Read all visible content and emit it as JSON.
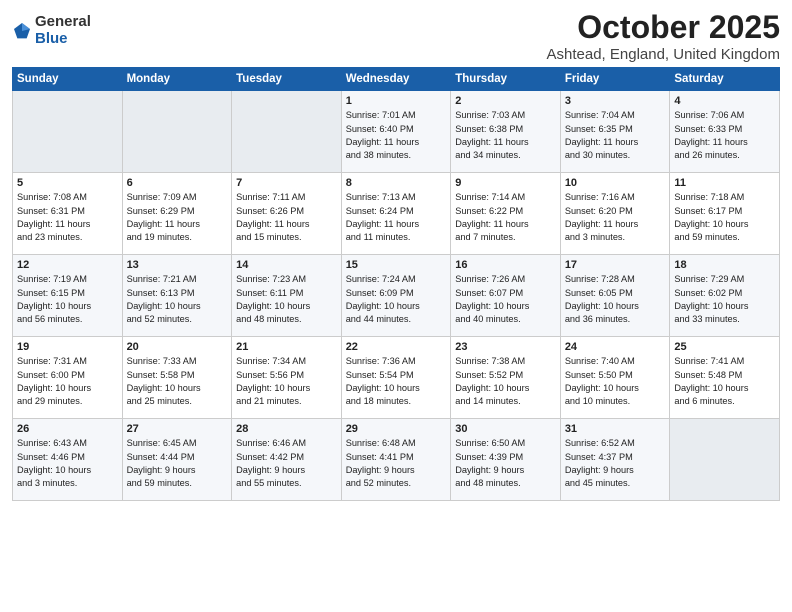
{
  "logo": {
    "general": "General",
    "blue": "Blue"
  },
  "header": {
    "month": "October 2025",
    "location": "Ashtead, England, United Kingdom"
  },
  "weekdays": [
    "Sunday",
    "Monday",
    "Tuesday",
    "Wednesday",
    "Thursday",
    "Friday",
    "Saturday"
  ],
  "weeks": [
    [
      {
        "day": "",
        "info": ""
      },
      {
        "day": "",
        "info": ""
      },
      {
        "day": "",
        "info": ""
      },
      {
        "day": "1",
        "info": "Sunrise: 7:01 AM\nSunset: 6:40 PM\nDaylight: 11 hours\nand 38 minutes."
      },
      {
        "day": "2",
        "info": "Sunrise: 7:03 AM\nSunset: 6:38 PM\nDaylight: 11 hours\nand 34 minutes."
      },
      {
        "day": "3",
        "info": "Sunrise: 7:04 AM\nSunset: 6:35 PM\nDaylight: 11 hours\nand 30 minutes."
      },
      {
        "day": "4",
        "info": "Sunrise: 7:06 AM\nSunset: 6:33 PM\nDaylight: 11 hours\nand 26 minutes."
      }
    ],
    [
      {
        "day": "5",
        "info": "Sunrise: 7:08 AM\nSunset: 6:31 PM\nDaylight: 11 hours\nand 23 minutes."
      },
      {
        "day": "6",
        "info": "Sunrise: 7:09 AM\nSunset: 6:29 PM\nDaylight: 11 hours\nand 19 minutes."
      },
      {
        "day": "7",
        "info": "Sunrise: 7:11 AM\nSunset: 6:26 PM\nDaylight: 11 hours\nand 15 minutes."
      },
      {
        "day": "8",
        "info": "Sunrise: 7:13 AM\nSunset: 6:24 PM\nDaylight: 11 hours\nand 11 minutes."
      },
      {
        "day": "9",
        "info": "Sunrise: 7:14 AM\nSunset: 6:22 PM\nDaylight: 11 hours\nand 7 minutes."
      },
      {
        "day": "10",
        "info": "Sunrise: 7:16 AM\nSunset: 6:20 PM\nDaylight: 11 hours\nand 3 minutes."
      },
      {
        "day": "11",
        "info": "Sunrise: 7:18 AM\nSunset: 6:17 PM\nDaylight: 10 hours\nand 59 minutes."
      }
    ],
    [
      {
        "day": "12",
        "info": "Sunrise: 7:19 AM\nSunset: 6:15 PM\nDaylight: 10 hours\nand 56 minutes."
      },
      {
        "day": "13",
        "info": "Sunrise: 7:21 AM\nSunset: 6:13 PM\nDaylight: 10 hours\nand 52 minutes."
      },
      {
        "day": "14",
        "info": "Sunrise: 7:23 AM\nSunset: 6:11 PM\nDaylight: 10 hours\nand 48 minutes."
      },
      {
        "day": "15",
        "info": "Sunrise: 7:24 AM\nSunset: 6:09 PM\nDaylight: 10 hours\nand 44 minutes."
      },
      {
        "day": "16",
        "info": "Sunrise: 7:26 AM\nSunset: 6:07 PM\nDaylight: 10 hours\nand 40 minutes."
      },
      {
        "day": "17",
        "info": "Sunrise: 7:28 AM\nSunset: 6:05 PM\nDaylight: 10 hours\nand 36 minutes."
      },
      {
        "day": "18",
        "info": "Sunrise: 7:29 AM\nSunset: 6:02 PM\nDaylight: 10 hours\nand 33 minutes."
      }
    ],
    [
      {
        "day": "19",
        "info": "Sunrise: 7:31 AM\nSunset: 6:00 PM\nDaylight: 10 hours\nand 29 minutes."
      },
      {
        "day": "20",
        "info": "Sunrise: 7:33 AM\nSunset: 5:58 PM\nDaylight: 10 hours\nand 25 minutes."
      },
      {
        "day": "21",
        "info": "Sunrise: 7:34 AM\nSunset: 5:56 PM\nDaylight: 10 hours\nand 21 minutes."
      },
      {
        "day": "22",
        "info": "Sunrise: 7:36 AM\nSunset: 5:54 PM\nDaylight: 10 hours\nand 18 minutes."
      },
      {
        "day": "23",
        "info": "Sunrise: 7:38 AM\nSunset: 5:52 PM\nDaylight: 10 hours\nand 14 minutes."
      },
      {
        "day": "24",
        "info": "Sunrise: 7:40 AM\nSunset: 5:50 PM\nDaylight: 10 hours\nand 10 minutes."
      },
      {
        "day": "25",
        "info": "Sunrise: 7:41 AM\nSunset: 5:48 PM\nDaylight: 10 hours\nand 6 minutes."
      }
    ],
    [
      {
        "day": "26",
        "info": "Sunrise: 6:43 AM\nSunset: 4:46 PM\nDaylight: 10 hours\nand 3 minutes."
      },
      {
        "day": "27",
        "info": "Sunrise: 6:45 AM\nSunset: 4:44 PM\nDaylight: 9 hours\nand 59 minutes."
      },
      {
        "day": "28",
        "info": "Sunrise: 6:46 AM\nSunset: 4:42 PM\nDaylight: 9 hours\nand 55 minutes."
      },
      {
        "day": "29",
        "info": "Sunrise: 6:48 AM\nSunset: 4:41 PM\nDaylight: 9 hours\nand 52 minutes."
      },
      {
        "day": "30",
        "info": "Sunrise: 6:50 AM\nSunset: 4:39 PM\nDaylight: 9 hours\nand 48 minutes."
      },
      {
        "day": "31",
        "info": "Sunrise: 6:52 AM\nSunset: 4:37 PM\nDaylight: 9 hours\nand 45 minutes."
      },
      {
        "day": "",
        "info": ""
      }
    ]
  ]
}
